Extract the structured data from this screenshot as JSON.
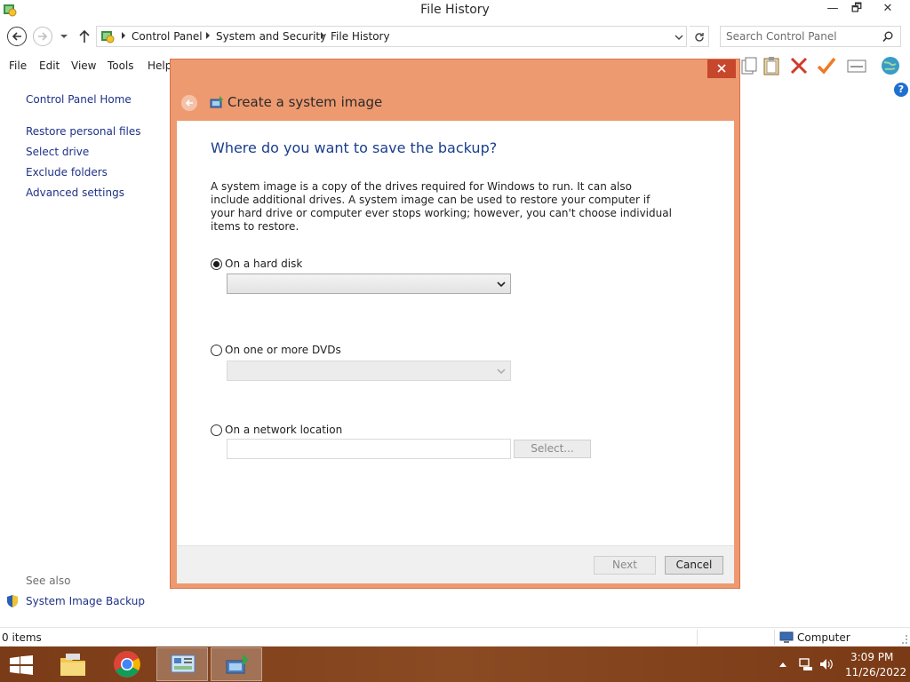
{
  "window": {
    "title": "File History",
    "icon": "file-history-icon",
    "controls": {
      "minimize": "—",
      "maximize": "🗗",
      "close": "✕"
    }
  },
  "address_bar": {
    "breadcrumbs": [
      "Control Panel",
      "System and Security",
      "File History"
    ],
    "search_placeholder": "Search Control Panel"
  },
  "menu": {
    "items": [
      "File",
      "Edit",
      "View",
      "Tools",
      "Help"
    ]
  },
  "left_pane": {
    "home_link": "Control Panel Home",
    "links": [
      "Restore personal files",
      "Select drive",
      "Exclude folders",
      "Advanced settings"
    ],
    "see_also_label": "See also",
    "see_also_links": [
      "System Image Backup"
    ]
  },
  "dialog": {
    "title": "Create a system image",
    "heading": "Where do you want to save the backup?",
    "description": "A system image is a copy of the drives required for Windows to run. It can also include additional drives. A system image can be used to restore your computer if your hard drive or computer ever stops working; however, you can't choose individual items to restore.",
    "options": [
      {
        "label": "On a hard disk",
        "selected": true
      },
      {
        "label": "On one or more DVDs",
        "selected": false
      },
      {
        "label": "On a network location",
        "selected": false
      }
    ],
    "hard_disk_value": "",
    "dvd_value": "",
    "network_path_value": "",
    "select_button": "Select...",
    "next_button": "Next",
    "cancel_button": "Cancel"
  },
  "status_bar": {
    "items_text": "0 items",
    "location": "Computer"
  },
  "taskbar": {
    "apps": [
      "file-explorer-icon",
      "chrome-icon",
      "control-panel-icon",
      "system-image-backup-icon"
    ],
    "time": "3:09 PM",
    "date": "11/26/2022"
  },
  "colors": {
    "dialog_frame": "#ee9a70",
    "dialog_close": "#c7472c",
    "link_blue": "#1e3287",
    "heading_blue": "#1a3e8c",
    "taskbar": "#7a3a16"
  }
}
